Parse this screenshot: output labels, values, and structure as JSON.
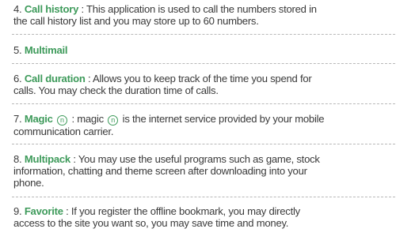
{
  "items": [
    {
      "num": "4.",
      "title": "Call history",
      "lines": [
        " : This application is used to call the numbers stored in",
        "the call history list and you may store up to 60 numbers."
      ]
    },
    {
      "num": "5.",
      "title": "Multimail",
      "lines": [
        ""
      ]
    },
    {
      "num": "6.",
      "title": "Call duration",
      "lines": [
        " : Allows you to keep track of the time you spend for",
        "calls. You may check the duration time of calls."
      ]
    },
    {
      "num": "7.",
      "title": "Magic",
      "symbol": "n",
      "line1_mid": " : magic ",
      "line1_end": " is the internet service provided by your mobile",
      "line2": "communication carrier."
    },
    {
      "num": "8.",
      "title": "Multipack",
      "lines": [
        " : You may use the useful programs such as game, stock",
        "information, chatting and theme screen after downloading into your",
        "phone."
      ]
    },
    {
      "num": "9.",
      "title": "Favorite",
      "lines": [
        " : If you register the offline bookmark, you may directly",
        "access to the site you want so, you may save time and money."
      ]
    }
  ]
}
